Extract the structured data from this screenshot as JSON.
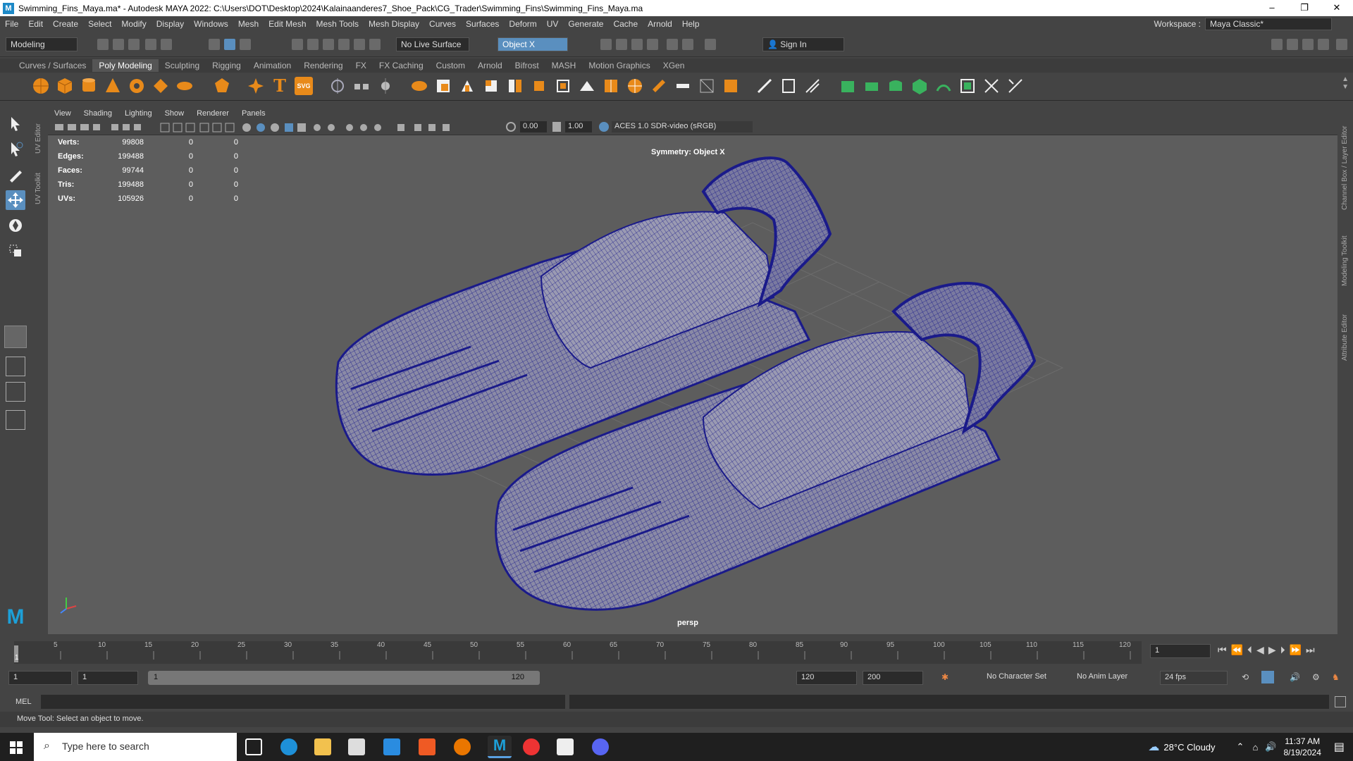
{
  "window": {
    "title": "Swimming_Fins_Maya.ma* - Autodesk MAYA 2022: C:\\Users\\DOT\\Desktop\\2024\\Kalainaanderes7_Shoe_Pack\\CG_Trader\\Swimming_Fins\\Swimming_Fins_Maya.ma",
    "minimize": "–",
    "restore": "❐",
    "close": "✕"
  },
  "menubar": {
    "items": [
      "File",
      "Edit",
      "Create",
      "Select",
      "Modify",
      "Display",
      "Windows",
      "Mesh",
      "Edit Mesh",
      "Mesh Tools",
      "Mesh Display",
      "Curves",
      "Surfaces",
      "Deform",
      "UV",
      "Generate",
      "Cache",
      "Arnold",
      "Help"
    ],
    "workspace_label": "Workspace :",
    "workspace_value": "Maya Classic*"
  },
  "statusline": {
    "mode": "Modeling",
    "live_surface": "No Live Surface",
    "symmetry": "Object X",
    "sign_in": "Sign In"
  },
  "shelf": {
    "tabs": [
      "Curves / Surfaces",
      "Poly Modeling",
      "Sculpting",
      "Rigging",
      "Animation",
      "Rendering",
      "FX",
      "FX Caching",
      "Custom",
      "Arnold",
      "Bifrost",
      "MASH",
      "Motion Graphics",
      "XGen"
    ],
    "active_tab": "Poly Modeling",
    "text_icon": "T",
    "svg_icon": "SVG"
  },
  "side_panels": {
    "left": [
      "UV Editor",
      "UV Toolkit"
    ],
    "right": [
      "Channel Box / Layer Editor",
      "Modeling Toolkit",
      "Attribute Editor"
    ]
  },
  "panel": {
    "menus": [
      "View",
      "Shading",
      "Lighting",
      "Show",
      "Renderer",
      "Panels"
    ],
    "exposure": "0.00",
    "gamma": "1.00",
    "color_space": "ACES 1.0 SDR-video (sRGB)"
  },
  "hud": {
    "rows": [
      {
        "label": "Verts:",
        "value": "99808",
        "sel": "0",
        "uv": "0"
      },
      {
        "label": "Edges:",
        "value": "199488",
        "sel": "0",
        "uv": "0"
      },
      {
        "label": "Faces:",
        "value": "99744",
        "sel": "0",
        "uv": "0"
      },
      {
        "label": "Tris:",
        "value": "199488",
        "sel": "0",
        "uv": "0"
      },
      {
        "label": "UVs:",
        "value": "105926",
        "sel": "0",
        "uv": "0"
      }
    ],
    "symmetry": "Symmetry: Object X",
    "camera": "persp"
  },
  "timeline": {
    "ticks": [
      "1",
      "5",
      "10",
      "15",
      "20",
      "25",
      "30",
      "35",
      "40",
      "45",
      "50",
      "55",
      "60",
      "65",
      "70",
      "75",
      "80",
      "85",
      "90",
      "95",
      "100",
      "105",
      "110",
      "115",
      "120"
    ],
    "current_frame": "1"
  },
  "range": {
    "start": "1",
    "playback_start": "1",
    "slider_start": "1",
    "slider_end": "120",
    "playback_end": "120",
    "end": "200",
    "character_set": "No Character Set",
    "anim_layer": "No Anim Layer",
    "fps": "24 fps"
  },
  "cmd": {
    "lang": "MEL"
  },
  "help_line": "Move Tool: Select an object to move.",
  "taskbar": {
    "search_placeholder": "Type here to search",
    "weather": "28°C  Cloudy",
    "time": "11:37 AM",
    "date": "8/19/2024"
  }
}
